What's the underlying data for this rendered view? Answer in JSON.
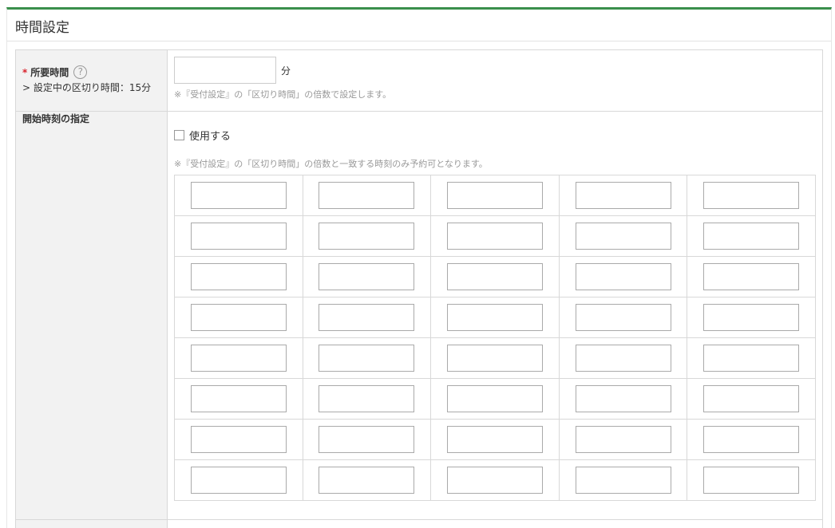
{
  "header": {
    "title": "時間設定"
  },
  "duration": {
    "required_mark": "*",
    "label": "所要時間",
    "help_icon": "?",
    "sub_note": "> 設定中の区切り時間：15分",
    "value": "",
    "unit": "分",
    "note": "※『受付設定』の「区切り時間」の倍数で設定します。"
  },
  "start_times": {
    "label": "開始時刻の指定",
    "use_label": "使用する",
    "use_checked": false,
    "note": "※『受付設定』の「区切り時間」の倍数と一致する時刻のみ予約可となります。",
    "rows": 8,
    "cols": 5,
    "values": [
      [
        "",
        "",
        "",
        "",
        ""
      ],
      [
        "",
        "",
        "",
        "",
        ""
      ],
      [
        "",
        "",
        "",
        "",
        ""
      ],
      [
        "",
        "",
        "",
        "",
        ""
      ],
      [
        "",
        "",
        "",
        "",
        ""
      ],
      [
        "",
        "",
        "",
        "",
        ""
      ],
      [
        "",
        "",
        "",
        "",
        ""
      ],
      [
        "",
        "",
        "",
        "",
        ""
      ]
    ]
  },
  "colors": {
    "accent": "#3a8f4c",
    "required": "#d9232d",
    "label_bg": "#f2f2f2",
    "note": "#999999"
  }
}
